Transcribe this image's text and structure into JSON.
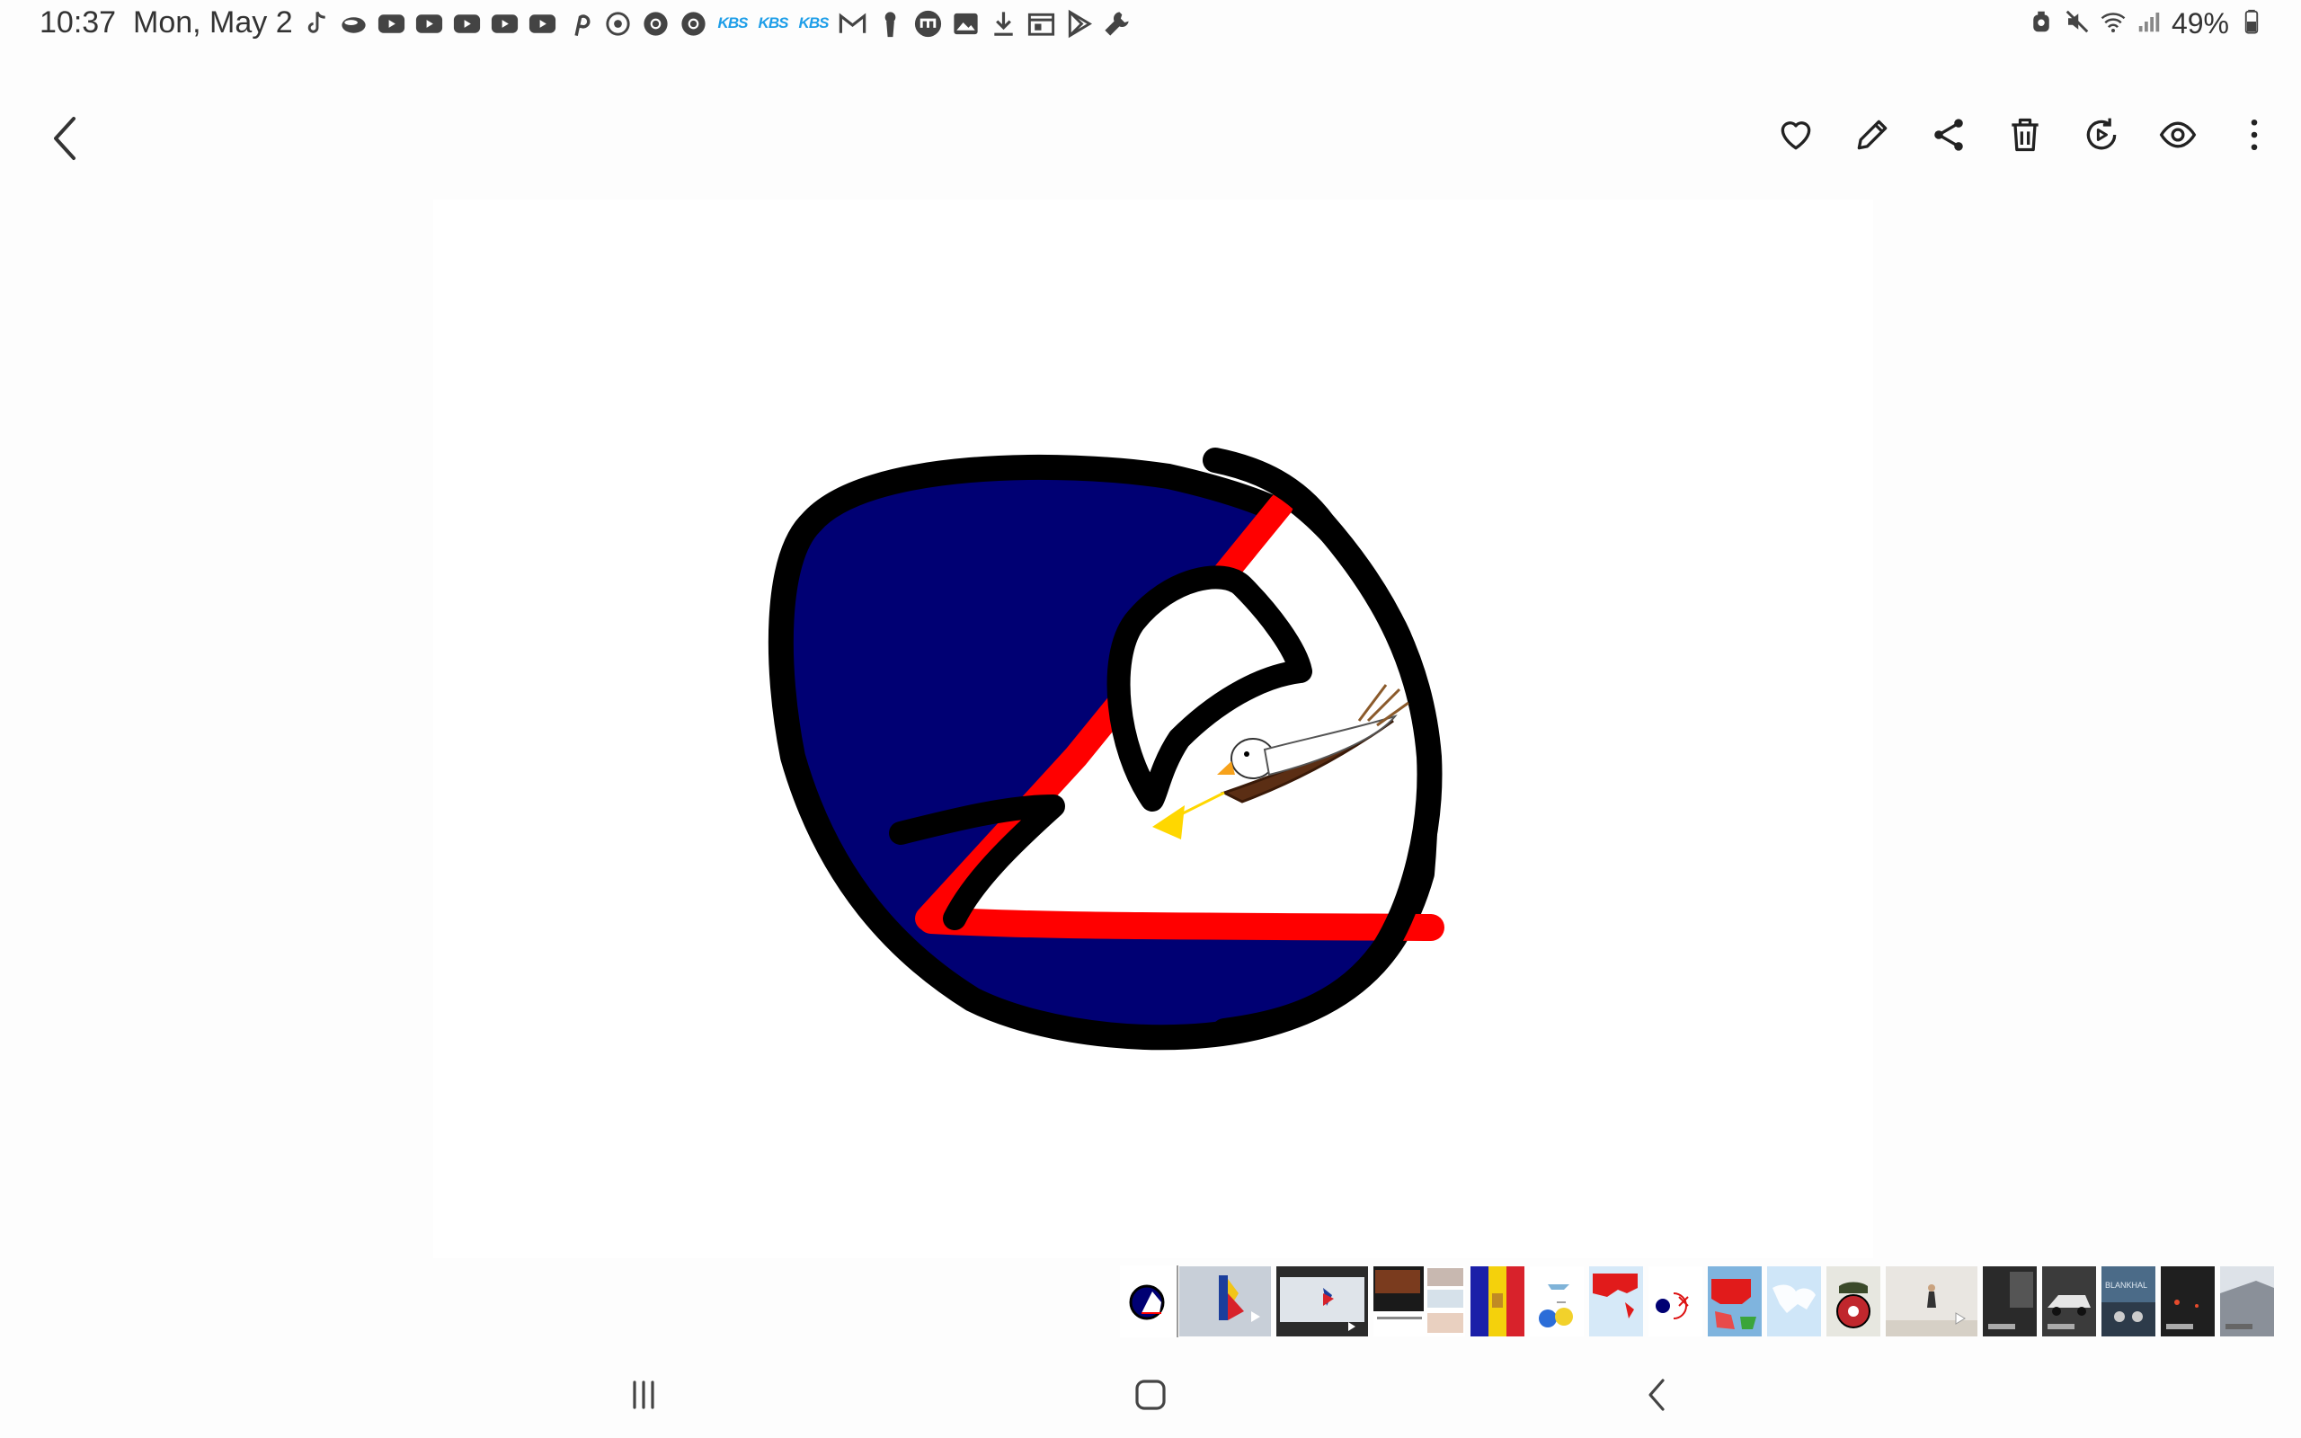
{
  "status_bar": {
    "time": "10:37",
    "date": "Mon, May 2",
    "battery_percent": "49%",
    "notification_icons": [
      "tiktok-icon",
      "cloud-app-icon",
      "youtube-icon",
      "youtube-icon",
      "youtube-icon",
      "youtube-icon",
      "youtube-icon",
      "pinterest-icon",
      "sync-app-icon",
      "chrome-icon",
      "chrome-icon",
      "kbs-icon",
      "kbs-icon",
      "kbs-icon",
      "gmail-icon",
      "keyhole-icon",
      "messenger-icon",
      "gallery-icon",
      "download-icon",
      "calendar-icon",
      "play-store-icon",
      "wrench-icon"
    ],
    "kbs_label": "KBS",
    "system_icons": [
      "alarm-icon",
      "mute-icon",
      "wifi-icon",
      "signal-icon",
      "battery-icon"
    ]
  },
  "toolbar": {
    "back_icon": "back-arrow-icon",
    "actions": [
      "heart-icon",
      "edit-pencil-icon",
      "share-icon",
      "trash-icon",
      "video-replay-icon",
      "eye-icon",
      "more-vertical-icon"
    ]
  },
  "image": {
    "subject": "countryball",
    "colors": {
      "ball": "#000073",
      "stripe": "#ff0000",
      "outline": "#000000",
      "eagle_beak": "#f7a21b",
      "arrow": "#ffd700"
    }
  },
  "filmstrip": {
    "thumbnails": [
      {
        "kind": "countryball",
        "selected": true
      },
      {
        "kind": "flag-video"
      },
      {
        "kind": "video-frame"
      },
      {
        "kind": "screenshot"
      },
      {
        "kind": "andorra-flag"
      },
      {
        "kind": "countryball-scene"
      },
      {
        "kind": "map"
      },
      {
        "kind": "countryball-scene"
      },
      {
        "kind": "map"
      },
      {
        "kind": "map"
      },
      {
        "kind": "countryball"
      },
      {
        "kind": "photo"
      },
      {
        "kind": "photo"
      },
      {
        "kind": "photo"
      },
      {
        "kind": "photo"
      },
      {
        "kind": "photo"
      },
      {
        "kind": "photo"
      }
    ],
    "thumb_text": "BLANKHAL"
  },
  "navbar": {
    "buttons": [
      "recent-apps-icon",
      "home-icon",
      "back-icon"
    ]
  }
}
